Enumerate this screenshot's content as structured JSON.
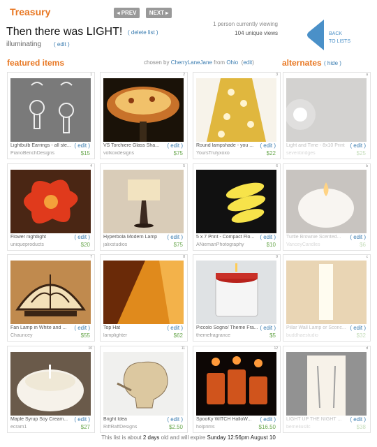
{
  "header": {
    "section": "Treasury",
    "prev_label": "◂ PREV",
    "next_label": "NEXT ▸",
    "title": "Then there was LIGHT!",
    "delete_list": "delete list",
    "subtitle": "illuminating",
    "sub_edit": "edit",
    "viewing": "1 person currently viewing",
    "unique_views": "104 unique views",
    "back_line1": "BACK",
    "back_line2": "TO LISTS"
  },
  "featured": {
    "heading": "featured items",
    "chosen_by": "chosen by",
    "curator": "CherryLaneJane",
    "from": "from",
    "location": "Ohio",
    "edit": "edit"
  },
  "alternates": {
    "heading": "alternates",
    "hide": "hide"
  },
  "items": [
    {
      "num": "1",
      "name": "Lightbulb Earrings - all ste...",
      "shop": "PianoBenchDesigns",
      "price": "$15",
      "edit": "edit"
    },
    {
      "num": "2",
      "name": "VS Torchiere Glass Sha...",
      "shop": "volkoxdesigns",
      "price": "$75",
      "edit": "edit"
    },
    {
      "num": "3",
      "name": "Round lampshade - you ...",
      "shop": "YoursTrulyxoxo",
      "price": "$22",
      "edit": "edit"
    },
    {
      "num": "4",
      "name": "Flower nightlight",
      "shop": "uniqueproducts",
      "price": "$20",
      "edit": "edit"
    },
    {
      "num": "5",
      "name": "Hyperbola Modern Lamp",
      "shop": "jalixstudios",
      "price": "$75",
      "edit": "edit"
    },
    {
      "num": "6",
      "name": "5 x 7 Print - Compact Flo...",
      "shop": "ANiemanPhotography",
      "price": "$10",
      "edit": "edit"
    },
    {
      "num": "7",
      "name": "Fan Lamp in White and ...",
      "shop": "Chauncey",
      "price": "$55",
      "edit": "edit"
    },
    {
      "num": "8",
      "name": "Top Hat",
      "shop": "lamplighter",
      "price": "$62",
      "edit": "edit"
    },
    {
      "num": "9",
      "name": "Piccolo Sogno/ Theme Fra...",
      "shop": "themefragrance",
      "price": "$5",
      "edit": "edit"
    },
    {
      "num": "10",
      "name": "Maple Syrup Soy Cream...",
      "shop": "ecram1",
      "price": "$27",
      "edit": "edit"
    },
    {
      "num": "11",
      "name": "Bright Idea",
      "shop": "RiffRaffDesigns",
      "price": "$2.50",
      "edit": "edit"
    },
    {
      "num": "12",
      "name": "SpooKy WITCH HalloW...",
      "shop": "holprims",
      "price": "$16.50",
      "edit": "edit"
    }
  ],
  "alt_items": [
    {
      "num": "a",
      "name": "Light and Time - 8x10 Print",
      "shop": "sevenbridges",
      "price": "$25",
      "edit": "edit"
    },
    {
      "num": "b",
      "name": "Turtle Brownie Scented...",
      "shop": "VanceyCandles",
      "price": "$6",
      "edit": "edit"
    },
    {
      "num": "c",
      "name": "Pillar Wall Lamp or Sconc...",
      "shop": "buddhaestudio",
      "price": "$32",
      "edit": "edit"
    },
    {
      "num": "d",
      "name": "LIGHT UP THE NIGHT ...",
      "shop": "bemeliusllc",
      "price": "$38",
      "edit": "edit"
    }
  ],
  "footer": {
    "pre": "This list is about",
    "age": "2 days",
    "mid": "old and will expire",
    "expiry": "Sunday 12:56pm  August 10"
  },
  "colors": {
    "accent": "#e87722",
    "link": "#3a7cb0",
    "price": "#6aa84f",
    "back_arrow": "#4a90c8"
  }
}
